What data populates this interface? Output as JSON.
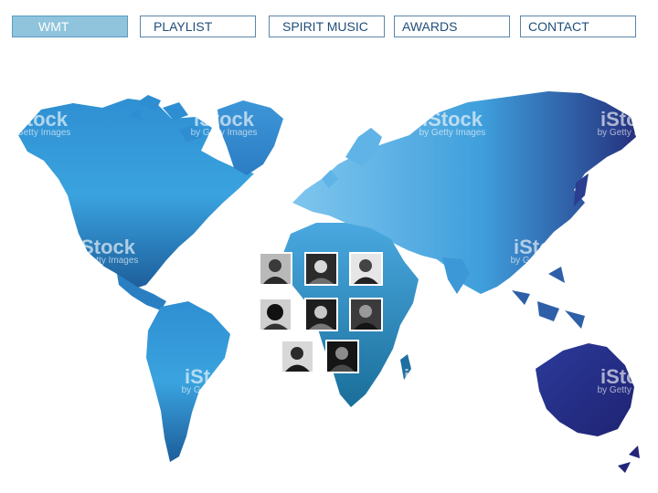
{
  "nav": {
    "items": [
      {
        "label": "WMT",
        "active": true
      },
      {
        "label": "PLAYLIST",
        "active": false
      },
      {
        "label": "SPIRIT MUSIC",
        "active": false
      },
      {
        "label": "AWARDS",
        "active": false
      },
      {
        "label": "CONTACT",
        "active": false
      }
    ]
  },
  "watermark": {
    "brand": "iStock",
    "sub": "by Getty Images"
  },
  "colors": {
    "nav_active_bg": "#8fc4dc",
    "nav_border": "#5b86a8",
    "map_light": "#4fb0e6",
    "map_dark": "#23237a"
  },
  "artists": [
    {
      "icon": "artist-photo-1"
    },
    {
      "icon": "artist-photo-2"
    },
    {
      "icon": "artist-photo-3"
    },
    {
      "icon": "artist-photo-4"
    },
    {
      "icon": "artist-photo-5"
    },
    {
      "icon": "artist-photo-6"
    },
    {
      "icon": "artist-photo-7"
    },
    {
      "icon": "artist-photo-8"
    }
  ]
}
